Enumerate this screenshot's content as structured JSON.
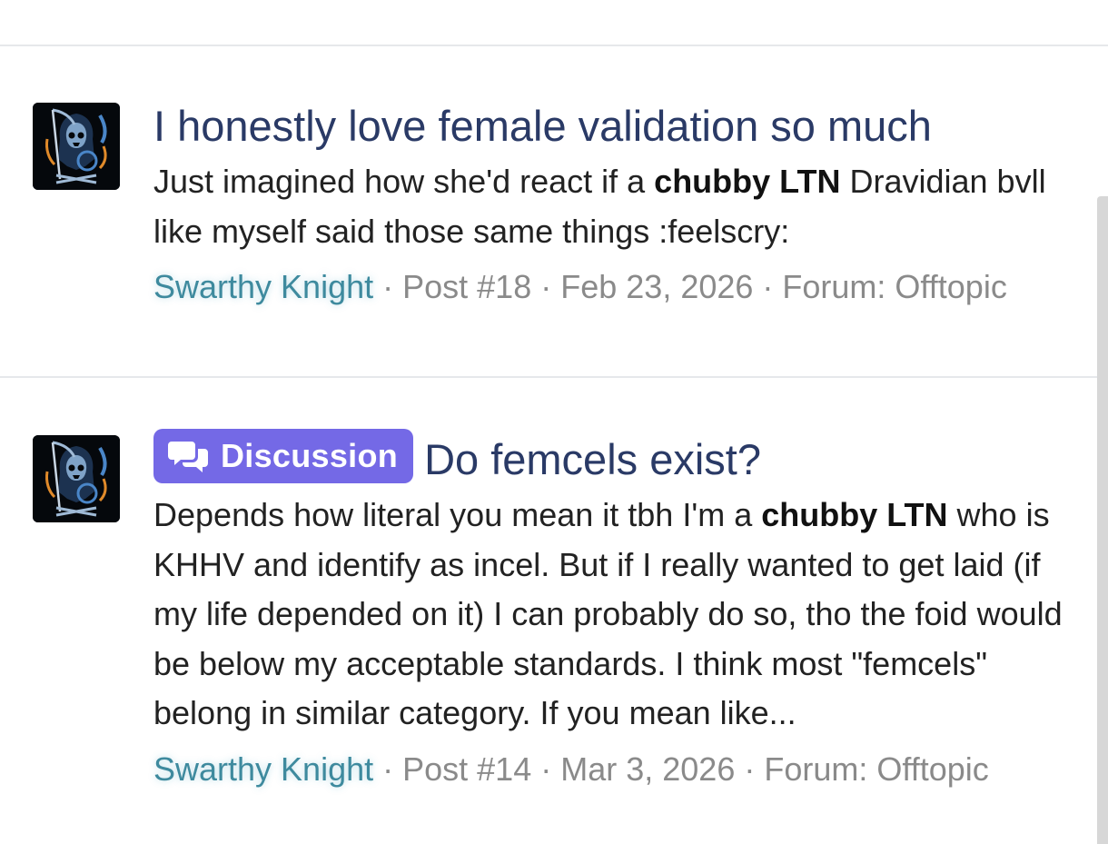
{
  "results": [
    {
      "title": "I honestly love female validation so much",
      "snippet": {
        "part1": "Just imagined how she'd react if a ",
        "bold": "chubby LTN",
        "part2": " Dravidian bvll like myself said those same things :feelscry:"
      },
      "author": "Swarthy Knight",
      "post": "Post #18",
      "date": "Feb 23, 2026",
      "forum": "Forum: Offtopic",
      "avatar_icon": "grim-reaper-avatar-icon"
    },
    {
      "prefix": "Discussion",
      "prefix_icon": "comments-icon",
      "prefix_color": "#7469e6",
      "title": "Do femcels exist?",
      "snippet": {
        "part1": "Depends how literal you mean it tbh I'm a ",
        "bold": "chubby LTN",
        "part2": " who is KHHV and identify as incel. But if I really wanted to get laid (if my life depended on it) I can probably do so, tho the foid would be below my acceptable standards. I think most \"femcels\" belong in similar category. If you mean like..."
      },
      "author": "Swarthy Knight",
      "post": "Post #14",
      "date": "Mar 3, 2026",
      "forum": "Forum: Offtopic",
      "avatar_icon": "grim-reaper-avatar-icon"
    }
  ],
  "meta_separator": " · ",
  "colors": {
    "title": "#2a3a66",
    "author": "#3e8a9e",
    "meta": "#8a8a8a",
    "text": "#222222"
  }
}
